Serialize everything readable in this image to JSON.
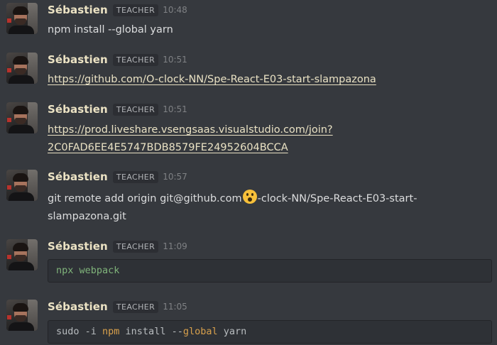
{
  "messages": [
    {
      "author": "Sébastien",
      "role_badge": "TEACHER",
      "time": "10:48",
      "text": "npm install --global yarn"
    },
    {
      "author": "Sébastien",
      "role_badge": "TEACHER",
      "time": "10:51",
      "link": "https://github.com/O-clock-NN/Spe-React-E03-start-slampazona"
    },
    {
      "author": "Sébastien",
      "role_badge": "TEACHER",
      "time": "10:51",
      "link_line1": "https://prod.liveshare.vsengsaas.visualstudio.com/join?",
      "link_line2": "2C0FAD6EE4E5747BDB8579FE24952604BCCA"
    },
    {
      "author": "Sébastien",
      "role_badge": "TEACHER",
      "time": "10:57",
      "text_before_emoji": "git remote add origin git@github.com",
      "emoji": "astonished-face",
      "text_after_emoji": "-clock-NN/Spe-React-E03-start-",
      "text_line2": "slampazona.git"
    },
    {
      "author": "Sébastien",
      "role_badge": "TEACHER",
      "time": "11:09",
      "code": "npx webpack"
    },
    {
      "author": "Sébastien",
      "role_badge": "TEACHER",
      "time": "11:05",
      "code_tokens": [
        "sudo -i ",
        "npm",
        " install --",
        "global",
        " yarn"
      ]
    }
  ],
  "colors": {
    "background": "#36393e",
    "author_name": "#ece3c4",
    "link": "#eae2c4",
    "code_green": "#7fb37a",
    "code_orange": "#d8a04c"
  }
}
